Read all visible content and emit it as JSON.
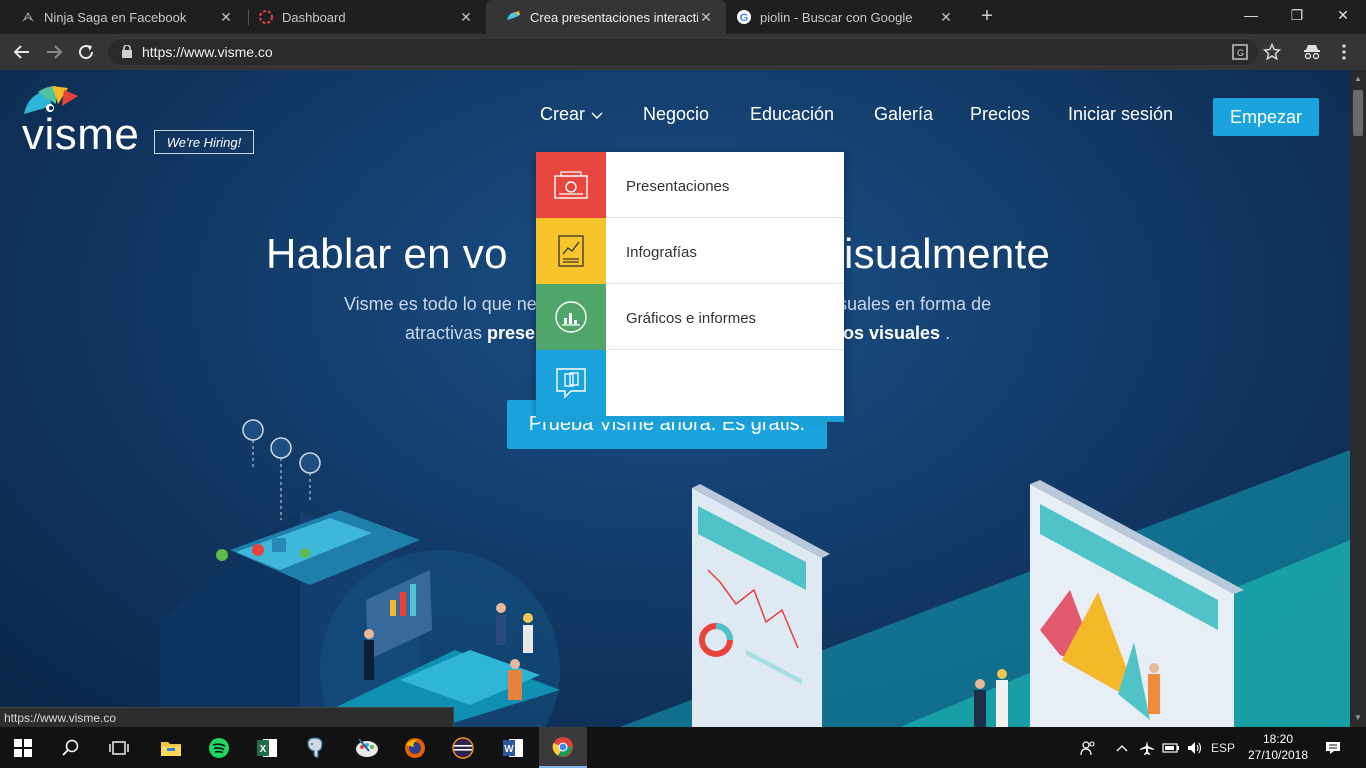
{
  "browser": {
    "tabs": [
      {
        "title": "Ninja Saga en Facebook",
        "active": false
      },
      {
        "title": "Dashboard",
        "active": false
      },
      {
        "title": "Crea presentaciones interactivas",
        "active": true
      },
      {
        "title": "piolin - Buscar con Google",
        "active": false
      }
    ],
    "url": "https://www.visme.co",
    "status_url": "https://www.visme.co"
  },
  "site": {
    "logo_text": "visme",
    "hiring_badge": "We're Hiring!",
    "nav": {
      "crear": "Crear",
      "negocio": "Negocio",
      "educacion": "Educación",
      "galeria": "Galería",
      "precios": "Precios",
      "login": "Iniciar sesión",
      "cta": "Empezar"
    },
    "hero": {
      "title_left": "Hablar en vo",
      "title_right": "isualmente",
      "sub_line1_left": "Visme es todo lo que nec",
      "sub_line1_right": "isuales en forma de",
      "sub_line2_left": "atractivas ",
      "sub_line2_left_bold": "presen",
      "sub_line2_right_bold": "os visuales",
      "sub_line2_right": " .",
      "cta": "Prueba Visme ahora. Es gratis."
    },
    "dropdown": {
      "items": [
        {
          "label": "Presentaciones",
          "color": "#e8473f",
          "icon": "presentation-icon"
        },
        {
          "label": "Infografías",
          "color": "#f3b928",
          "icon": "infographic-icon"
        },
        {
          "label": "Gráficos e informes",
          "color": "#4fa56a",
          "icon": "chart-report-icon"
        },
        {
          "label": "",
          "color": "#1ba3dd",
          "icon": "speech-document-icon"
        }
      ]
    }
  },
  "taskbar": {
    "language": "ESP",
    "time": "18:20",
    "date": "27/10/2018"
  }
}
